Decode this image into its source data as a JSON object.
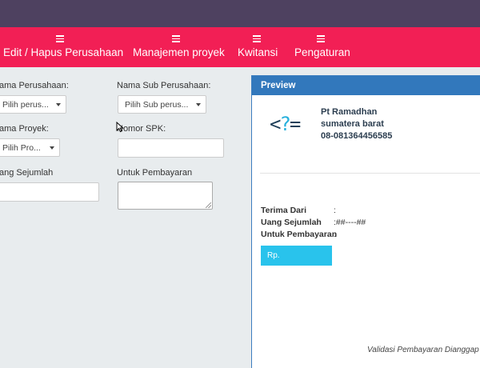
{
  "nav": {
    "items": [
      {
        "label": "Edit / Hapus Perusahaan",
        "icon": "list-icon"
      },
      {
        "label": "Manajemen proyek",
        "icon": "list-icon"
      },
      {
        "label": "Kwitansi",
        "icon": "list-icon"
      },
      {
        "label": "Pengaturan",
        "icon": "list-icon"
      }
    ]
  },
  "form": {
    "nama_perusahaan_label": "ama Perusahaan:",
    "nama_perusahaan_value": "Pilih perus...",
    "nama_sub_label": "Nama Sub Perusahaan:",
    "nama_sub_value": "Pilih Sub perus...",
    "nama_proyek_label": "ama Proyek:",
    "nama_proyek_value": "Pilih Pro...",
    "nomor_spk_label": "Nomor SPK:",
    "uang_sejumlah_label": "ang Sejumlah",
    "untuk_pembayaran_label": "Untuk Pembayaran"
  },
  "preview": {
    "title": "Preview",
    "logo_left": "<",
    "logo_q": "?",
    "logo_right": "=",
    "company_name": "Pt Ramadhan",
    "company_region": "sumatera barat",
    "company_phone": "08-081364456585",
    "terima_dari_label": "Terima Dari",
    "terima_dari_value": ":",
    "uang_sejumlah_label": "Uang Sejumlah",
    "uang_sejumlah_value": ":##----##",
    "untuk_pembayaran_label": "Untuk Pembayaran",
    "untuk_pembayaran_value": ":",
    "rp_label": "Rp.",
    "validasi_text": "Validasi Pembayaran Dianggap sa"
  },
  "colors": {
    "topbar": "#4e4160",
    "navbar": "#f21f55",
    "preview_header": "#3278bc",
    "rp_box": "#29c3ec"
  }
}
